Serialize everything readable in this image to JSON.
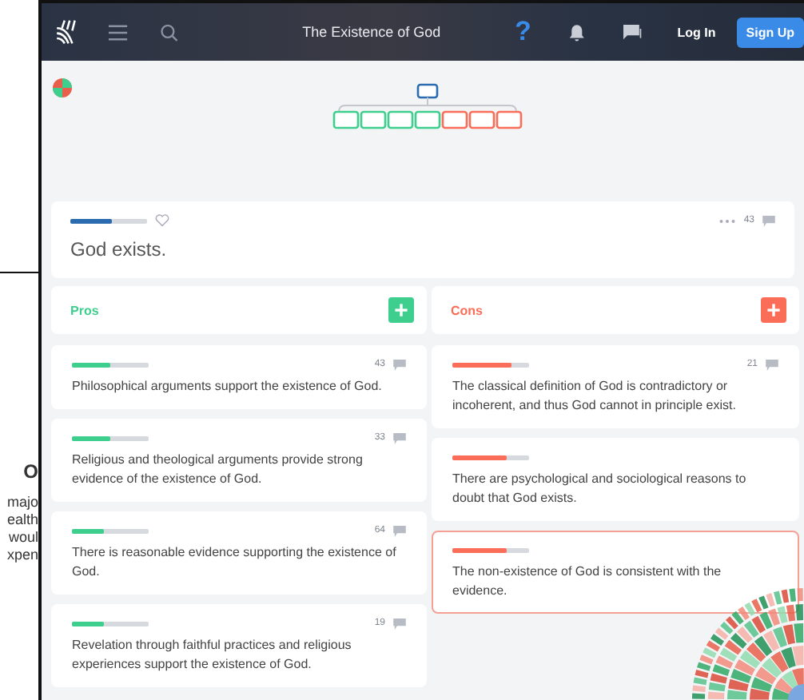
{
  "background_fragments": [
    "O",
    "majo",
    "ealth",
    "woul",
    "xpen"
  ],
  "topbar": {
    "title": "The Existence of God",
    "help": "?",
    "login": "Log In",
    "signup": "Sign Up"
  },
  "tree": {
    "children": [
      {
        "kind": "pro"
      },
      {
        "kind": "pro"
      },
      {
        "kind": "pro"
      },
      {
        "kind": "pro"
      },
      {
        "kind": "con"
      },
      {
        "kind": "con"
      },
      {
        "kind": "con"
      }
    ]
  },
  "thesis": {
    "text": "God exists.",
    "level": 0.55,
    "count": "43"
  },
  "columns": [
    {
      "kind": "pro",
      "title": "Pros",
      "add": "+",
      "claims": [
        {
          "text": "Philosophical arguments support the existence of God.",
          "level": 0.5,
          "count": "43",
          "selected": false
        },
        {
          "text": "Religious and theological arguments provide strong evidence of the existence of God.",
          "level": 0.5,
          "count": "33",
          "selected": false
        },
        {
          "text": "There is reasonable evidence supporting the existence of God.",
          "level": 0.42,
          "count": "64",
          "selected": false
        },
        {
          "text": "Revelation through faithful practices and religious experiences support the existence of God.",
          "level": 0.42,
          "count": "19",
          "selected": false
        }
      ]
    },
    {
      "kind": "con",
      "title": "Cons",
      "add": "+",
      "claims": [
        {
          "text": "The classical definition of God is contradictory or incoherent, and thus God cannot in principle exist.",
          "level": 0.78,
          "count": "21",
          "selected": false
        },
        {
          "text": "There are psychological and sociological reasons to doubt that God exists.",
          "level": 0.7,
          "selected": false
        },
        {
          "text": "The non-existence of God is consistent with the evidence.",
          "level": 0.7,
          "selected": true
        }
      ]
    }
  ]
}
